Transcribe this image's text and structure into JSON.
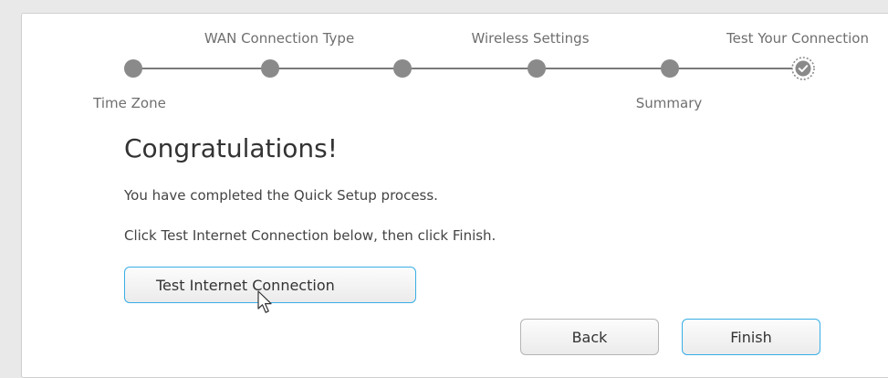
{
  "wizard": {
    "steps_top": [
      "WAN Connection Type",
      "Wireless Settings",
      "Test Your Connection"
    ],
    "steps_bottom": [
      "Time Zone",
      "Summary"
    ],
    "current_step": "Test Your Connection",
    "colors": {
      "completed_dot": "#8a8a8a",
      "line": "#7a7a7a"
    }
  },
  "main": {
    "title": "Congratulations!",
    "line1": "You have completed the Quick Setup process.",
    "line2": "Click Test Internet Connection below, then click Finish."
  },
  "buttons": {
    "test": "Test Internet Connection",
    "back": "Back",
    "finish": "Finish"
  },
  "colors": {
    "accent_border": "#39aee6"
  }
}
